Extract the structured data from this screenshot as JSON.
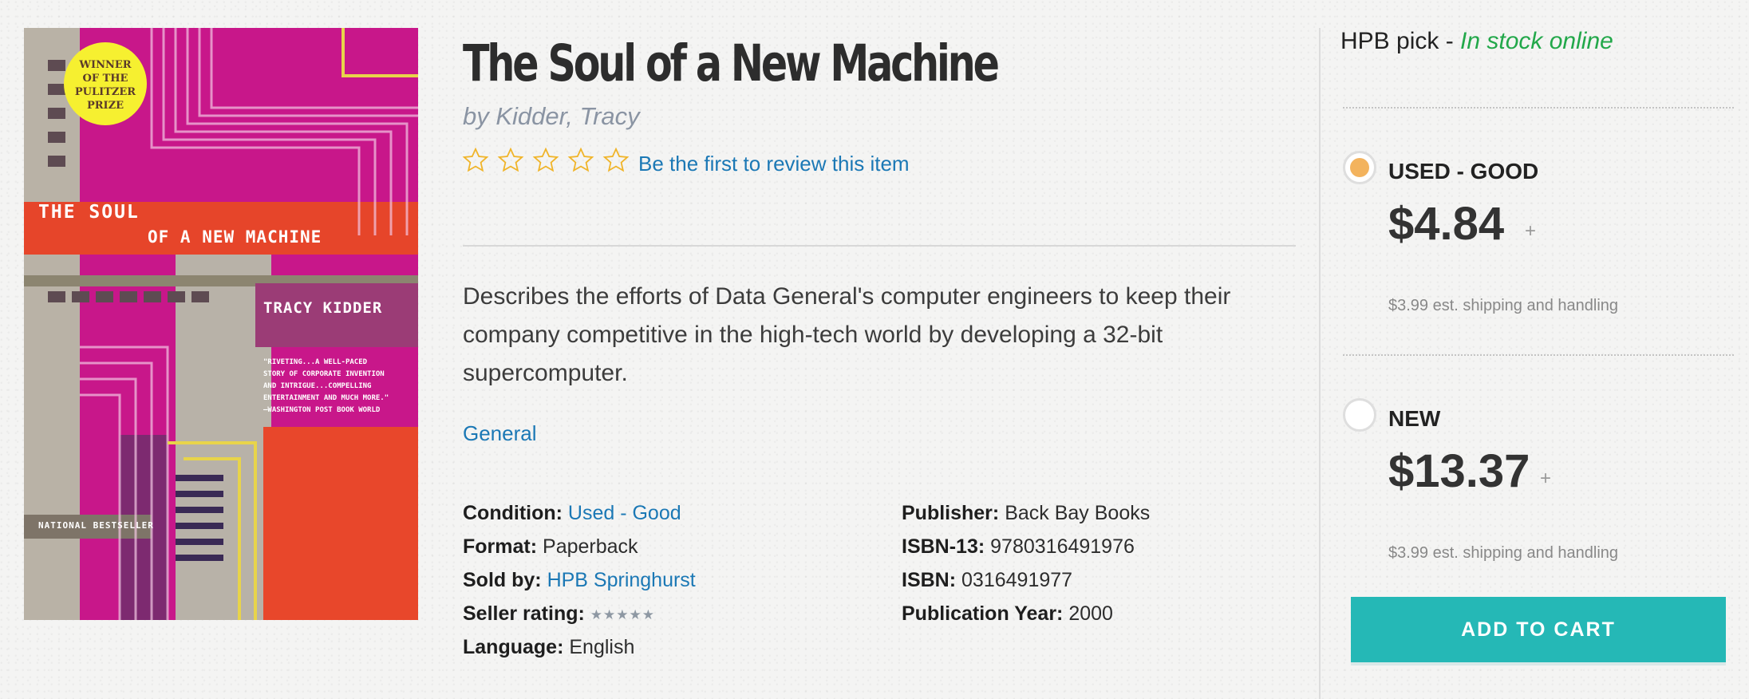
{
  "product": {
    "title": "The Soul of a New Machine",
    "author": "by Kidder, Tracy",
    "rating_stars": 0,
    "review_link": "Be the first to review this item",
    "description": "Describes the efforts of Data General's computer engineers to keep their company competitive in the high-tech world by developing a 32-bit supercomputer.",
    "category": "General"
  },
  "cover": {
    "badge_lines": [
      "WINNER",
      "OF THE",
      "PULITZER",
      "PRIZE"
    ],
    "title_line1": "THE SOUL",
    "title_line2": "OF A NEW MACHINE",
    "author": "TRACY KIDDER",
    "blurb_lines": [
      "\"RIVETING...A WELL-PACED",
      "STORY OF CORPORATE INVENTION",
      "AND INTRIGUE...COMPELLING",
      "ENTERTAINMENT AND MUCH MORE.\"",
      "—WASHINGTON POST BOOK WORLD"
    ],
    "bestseller": "NATIONAL BESTSELLER"
  },
  "details": {
    "condition_label": "Condition:",
    "condition_value": "Used - Good",
    "format_label": "Format:",
    "format_value": "Paperback",
    "sold_by_label": "Sold by:",
    "sold_by_value": "HPB Springhurst",
    "seller_rating_label": "Seller rating:",
    "seller_rating_stars": 5,
    "language_label": "Language:",
    "language_value": "English",
    "publisher_label": "Publisher:",
    "publisher_value": "Back Bay Books",
    "isbn13_label": "ISBN-13:",
    "isbn13_value": "9780316491976",
    "isbn_label": "ISBN:",
    "isbn_value": "0316491977",
    "pubyear_label": "Publication Year:",
    "pubyear_value": "2000"
  },
  "purchase": {
    "pick_label": "HPB pick - ",
    "stock_status": "In stock online",
    "options": [
      {
        "condition": "USED - GOOD",
        "price": "$4.84",
        "plus": "+",
        "shipping": "$3.99 est. shipping and handling",
        "selected": true
      },
      {
        "condition": "NEW",
        "price": "$13.37",
        "plus": "+",
        "shipping": "$3.99 est. shipping and handling",
        "selected": false
      }
    ],
    "add_to_cart": "ADD TO CART"
  },
  "colors": {
    "link": "#1b78b5",
    "stock": "#22a84a",
    "radio_selected": "#f3b35d",
    "cart_button": "#25b8b6",
    "star_outline": "#f0b429"
  },
  "icons": [
    "star-outline-icon",
    "radio-selected-icon",
    "radio-empty-icon"
  ]
}
